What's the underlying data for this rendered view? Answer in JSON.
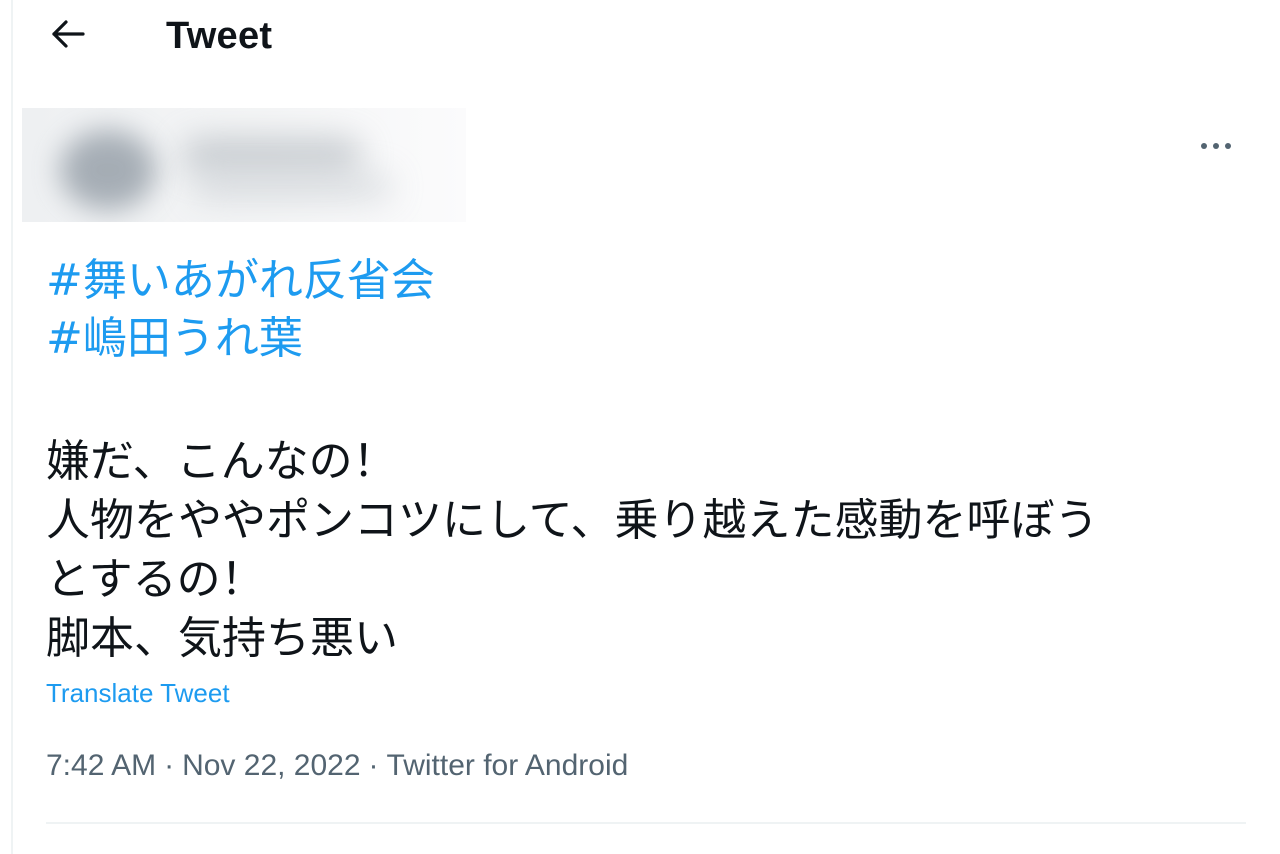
{
  "header": {
    "back_icon": "arrow-left-icon",
    "title": "Tweet"
  },
  "author": {
    "avatar": "blurred",
    "name": "",
    "handle": ""
  },
  "more_icon": "ellipsis-icon",
  "tweet": {
    "hashtags": [
      "#舞いあがれ反省会",
      "#嶋田うれ葉"
    ],
    "lines": [
      "嫌だ、こんなの！",
      "人物をややポンコツにして、乗り越えた感動を呼ぼう",
      "とするの！",
      "脚本、気持ち悪い"
    ],
    "translate_label": "Translate Tweet"
  },
  "meta": {
    "time": "7:42 AM",
    "date": "Nov 22, 2022",
    "source": "Twitter for Android",
    "separator": "·"
  },
  "colors": {
    "accent": "#1d9bf0",
    "text_primary": "#0f1419",
    "text_secondary": "#536471",
    "border": "#eff3f4"
  }
}
